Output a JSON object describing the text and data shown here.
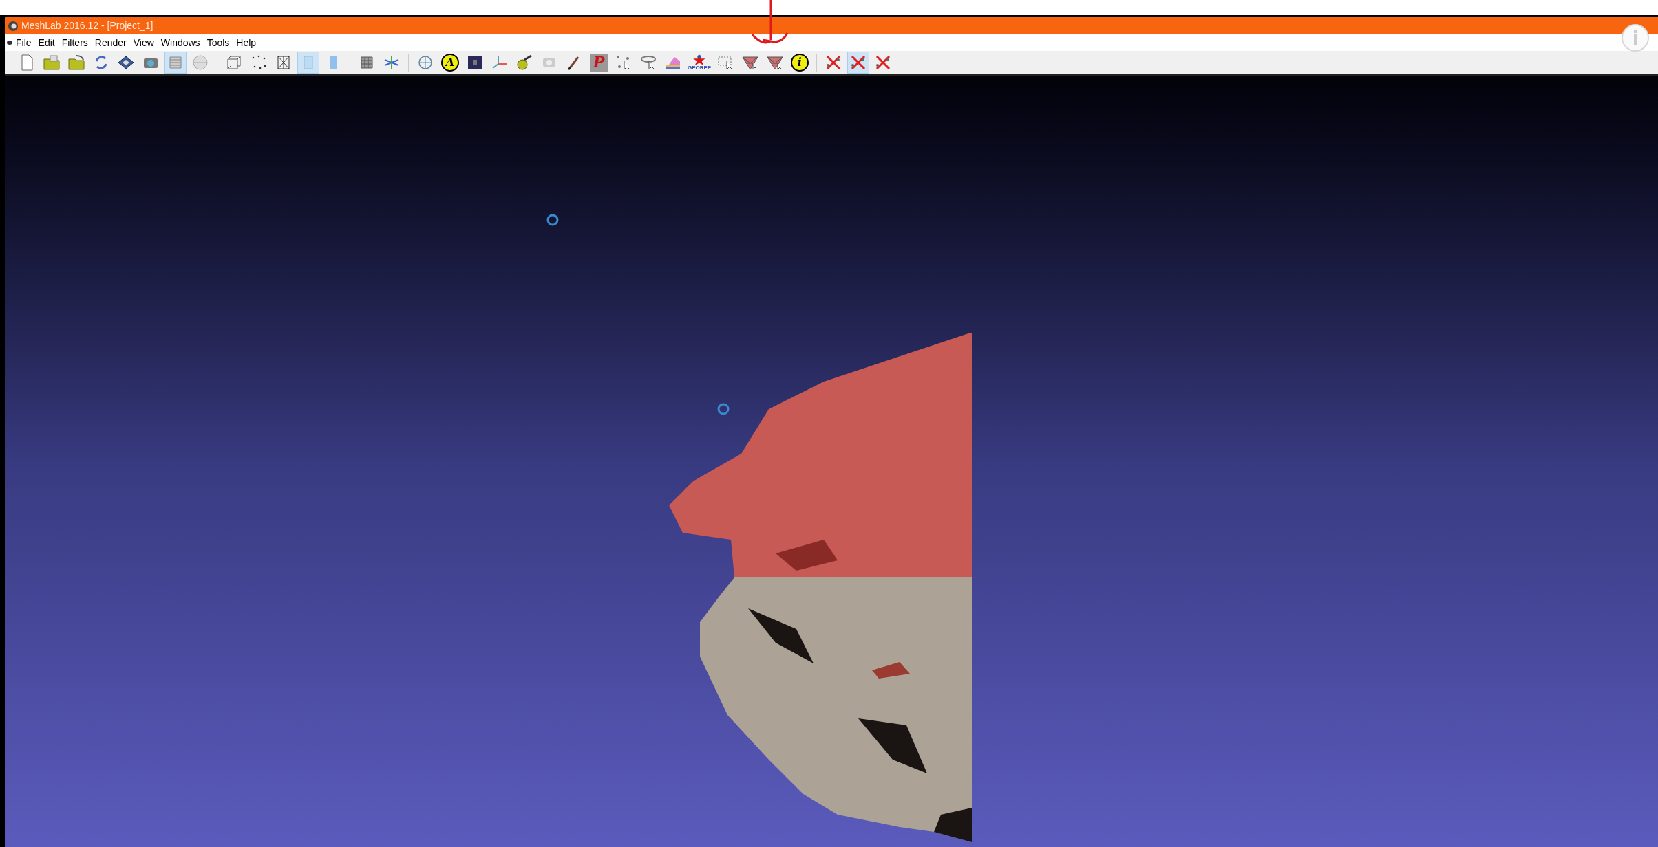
{
  "window": {
    "title": "MeshLab 2016.12 - [Project_1]"
  },
  "menu": [
    "File",
    "Edit",
    "Filters",
    "Render",
    "View",
    "Windows",
    "Tools",
    "Help"
  ],
  "toolbar": [
    {
      "kind": "new-file",
      "selected": false
    },
    {
      "kind": "open-folder",
      "selected": false
    },
    {
      "kind": "open-folder-arrow",
      "selected": false
    },
    {
      "kind": "reload",
      "selected": false
    },
    {
      "kind": "save",
      "selected": false
    },
    {
      "kind": "camera",
      "selected": false
    },
    {
      "kind": "layers",
      "selected": true
    },
    {
      "kind": "sphere",
      "selected": false
    },
    {
      "kind": "separator"
    },
    {
      "kind": "box",
      "selected": false
    },
    {
      "kind": "points",
      "selected": false
    },
    {
      "kind": "wireframe",
      "selected": false
    },
    {
      "kind": "cylinder",
      "selected": true
    },
    {
      "kind": "cylinder-flat",
      "selected": false
    },
    {
      "kind": "separator"
    },
    {
      "kind": "grid",
      "selected": false
    },
    {
      "kind": "axes-arrows",
      "selected": false
    },
    {
      "kind": "separator"
    },
    {
      "kind": "globe",
      "selected": false
    },
    {
      "kind": "letter",
      "label": "A",
      "selected": false
    },
    {
      "kind": "dark-square",
      "selected": false
    },
    {
      "kind": "axes",
      "selected": false
    },
    {
      "kind": "paint-bucket",
      "selected": false
    },
    {
      "kind": "gray-camera",
      "selected": false
    },
    {
      "kind": "brush",
      "selected": false
    },
    {
      "kind": "pp",
      "label": "P",
      "selected": false
    },
    {
      "kind": "select-points",
      "selected": false
    },
    {
      "kind": "select-connected",
      "selected": false
    },
    {
      "kind": "rainbow",
      "selected": false
    },
    {
      "kind": "star",
      "label": "GEOREF",
      "selected": false
    },
    {
      "kind": "select-rect",
      "selected": false
    },
    {
      "kind": "triangles",
      "selected": false
    },
    {
      "kind": "triangles",
      "selected": false
    },
    {
      "kind": "letter",
      "label": "i",
      "selected": false
    },
    {
      "kind": "separator"
    },
    {
      "kind": "cross",
      "selected": false
    },
    {
      "kind": "cross",
      "selected": true
    },
    {
      "kind": "cross",
      "selected": false
    }
  ]
}
